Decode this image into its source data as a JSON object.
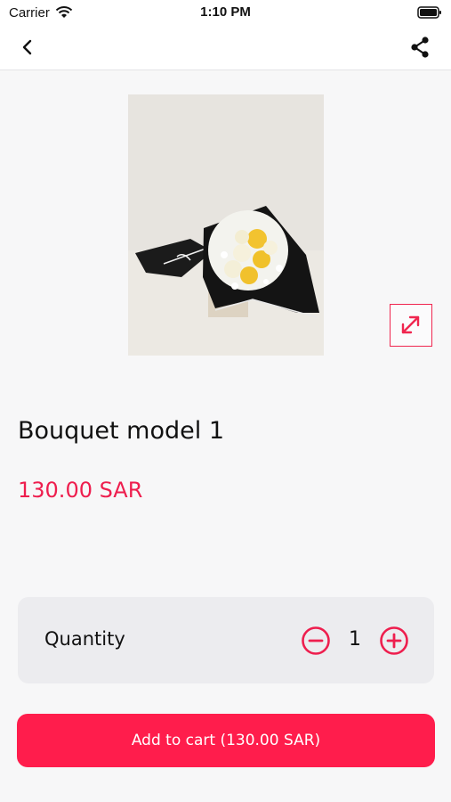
{
  "status_bar": {
    "carrier": "Carrier",
    "time": "1:10 PM"
  },
  "nav": {
    "back_icon": "chevron-left-icon",
    "share_icon": "share-icon"
  },
  "product": {
    "image_alt": "Bouquet photo",
    "name": "Bouquet model 1",
    "price": "130.00 SAR",
    "accent_color": "#ee1e4e"
  },
  "quantity": {
    "label": "Quantity",
    "value": "1",
    "minus_icon": "minus-circle-icon",
    "plus_icon": "plus-circle-icon"
  },
  "cart_button": {
    "label": "Add to cart (130.00 SAR)",
    "color": "#ff1d4c"
  }
}
